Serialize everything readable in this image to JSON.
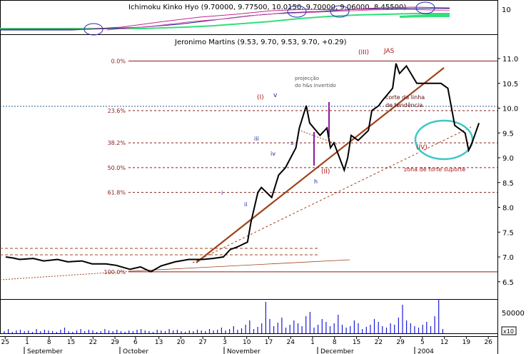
{
  "colors": {
    "price": "#000000",
    "trend": "#a0421b",
    "fib": "#8b1a1a",
    "dashed": "#a0421b",
    "cyan": "#3fc7c7",
    "volume": "#1a1ad8",
    "annot_red": "#b01818",
    "annot_blue": "#1a1a9a",
    "ichimoku_magenta": "#c0288a",
    "ichimoku_green": "#30e07a",
    "ichimoku_navy": "#1a1a80",
    "ellipse_blue": "#2a2ab0",
    "background": "#ffffff"
  },
  "ichimoku": {
    "title": "Ichimoku Kinko Hyo (9.70000, 9.77500, 10.0150, 9.70000, 9.06000, 8.45500)",
    "y_tick": "10"
  },
  "main": {
    "title": "Jeronimo Martins (9.53, 9.70, 9.53, 9.70, +0.29)",
    "y_ticks": [
      "11.0",
      "10.5",
      "10.0",
      "9.5",
      "9.0",
      "8.5",
      "8.0",
      "7.5",
      "7.0",
      "6.5"
    ],
    "fib_labels": [
      "0.0%",
      "23.6%",
      "38.2%",
      "50.0%",
      "61.8%",
      "100.0%"
    ],
    "annotations": {
      "wave_III": "(III)",
      "jas": "JAS",
      "wave_I": "(I)",
      "v_label": "v",
      "projection": "projecção do h&s invertido",
      "iii": "iii",
      "iv": "iv",
      "i_label": "i",
      "ii": "ii",
      "s_label": "s",
      "h_label": "h",
      "wave_II": "(II)",
      "corte": "corte da linha de tendência",
      "wave_IV": "(IV)",
      "zona": "zona de forte suporte"
    }
  },
  "volume": {
    "y_tick": "50000",
    "multiplier": "x10"
  },
  "x_axis": {
    "day_ticks": [
      "25",
      "1",
      "8",
      "15",
      "22",
      "29",
      "6",
      "13",
      "20",
      "27",
      "3",
      "10",
      "17",
      "24",
      "1",
      "8",
      "15",
      "22",
      "29",
      "5",
      "12",
      "19",
      "26"
    ],
    "months": [
      "September",
      "October",
      "November",
      "December",
      "2004"
    ]
  },
  "chart_data": {
    "type": "line",
    "title": "Jeronimo Martins (9.53, 9.70, 9.53, 9.70, +0.29)",
    "xlabel": "",
    "ylabel": "",
    "ylim": [
      6.3,
      11.3
    ],
    "x_range": [
      "2003-08-25",
      "2004-01-28"
    ],
    "series": [
      {
        "points": [
          [
            "2003-08-25",
            7.0
          ],
          [
            "2003-08-27",
            6.98
          ],
          [
            "2003-08-29",
            6.95
          ],
          [
            "2003-09-02",
            6.97
          ],
          [
            "2003-09-05",
            6.92
          ],
          [
            "2003-09-09",
            6.95
          ],
          [
            "2003-09-12",
            6.9
          ],
          [
            "2003-09-16",
            6.92
          ],
          [
            "2003-09-19",
            6.86
          ],
          [
            "2003-09-23",
            6.86
          ],
          [
            "2003-09-26",
            6.83
          ],
          [
            "2003-09-30",
            6.75
          ],
          [
            "2003-10-03",
            6.8
          ],
          [
            "2003-10-06",
            6.7
          ],
          [
            "2003-10-09",
            6.82
          ],
          [
            "2003-10-13",
            6.9
          ],
          [
            "2003-10-17",
            6.95
          ],
          [
            "2003-10-21",
            6.95
          ],
          [
            "2003-10-24",
            6.97
          ],
          [
            "2003-10-27",
            7.0
          ],
          [
            "2003-10-29",
            7.15
          ],
          [
            "2003-10-31",
            7.2
          ],
          [
            "2003-11-03",
            7.3
          ],
          [
            "2003-11-04",
            7.7
          ],
          [
            "2003-11-06",
            8.3
          ],
          [
            "2003-11-07",
            8.4
          ],
          [
            "2003-11-10",
            8.2
          ],
          [
            "2003-11-12",
            8.65
          ],
          [
            "2003-11-14",
            8.8
          ],
          [
            "2003-11-17",
            9.2
          ],
          [
            "2003-11-18",
            9.6
          ],
          [
            "2003-11-20",
            10.05
          ],
          [
            "2003-11-21",
            9.7
          ],
          [
            "2003-11-24",
            9.45
          ],
          [
            "2003-11-26",
            9.6
          ],
          [
            "2003-11-27",
            9.2
          ],
          [
            "2003-11-28",
            9.3
          ],
          [
            "2003-12-01",
            8.75
          ],
          [
            "2003-12-02",
            9.0
          ],
          [
            "2003-12-03",
            9.45
          ],
          [
            "2003-12-05",
            9.35
          ],
          [
            "2003-12-08",
            9.55
          ],
          [
            "2003-12-09",
            9.95
          ],
          [
            "2003-12-11",
            10.05
          ],
          [
            "2003-12-12",
            10.15
          ],
          [
            "2003-12-15",
            10.4
          ],
          [
            "2003-12-16",
            10.9
          ],
          [
            "2003-12-17",
            10.7
          ],
          [
            "2003-12-19",
            10.85
          ],
          [
            "2003-12-22",
            10.5
          ],
          [
            "2003-12-29",
            10.5
          ],
          [
            "2003-12-31",
            10.4
          ],
          [
            "2004-01-02",
            9.65
          ],
          [
            "2004-01-05",
            9.5
          ],
          [
            "2004-01-06",
            9.15
          ],
          [
            "2004-01-07",
            9.3
          ],
          [
            "2004-01-09",
            9.7
          ]
        ]
      }
    ],
    "fibonacci_levels": [
      {
        "label": "0.0%",
        "value": 10.95
      },
      {
        "label": "23.6%",
        "value": 9.95
      },
      {
        "label": "38.2%",
        "value": 9.3
      },
      {
        "label": "50.0%",
        "value": 8.8
      },
      {
        "label": "61.8%",
        "value": 8.3
      },
      {
        "label": "100.0%",
        "value": 6.7
      }
    ],
    "volume_ylabel_tick": 50000
  }
}
